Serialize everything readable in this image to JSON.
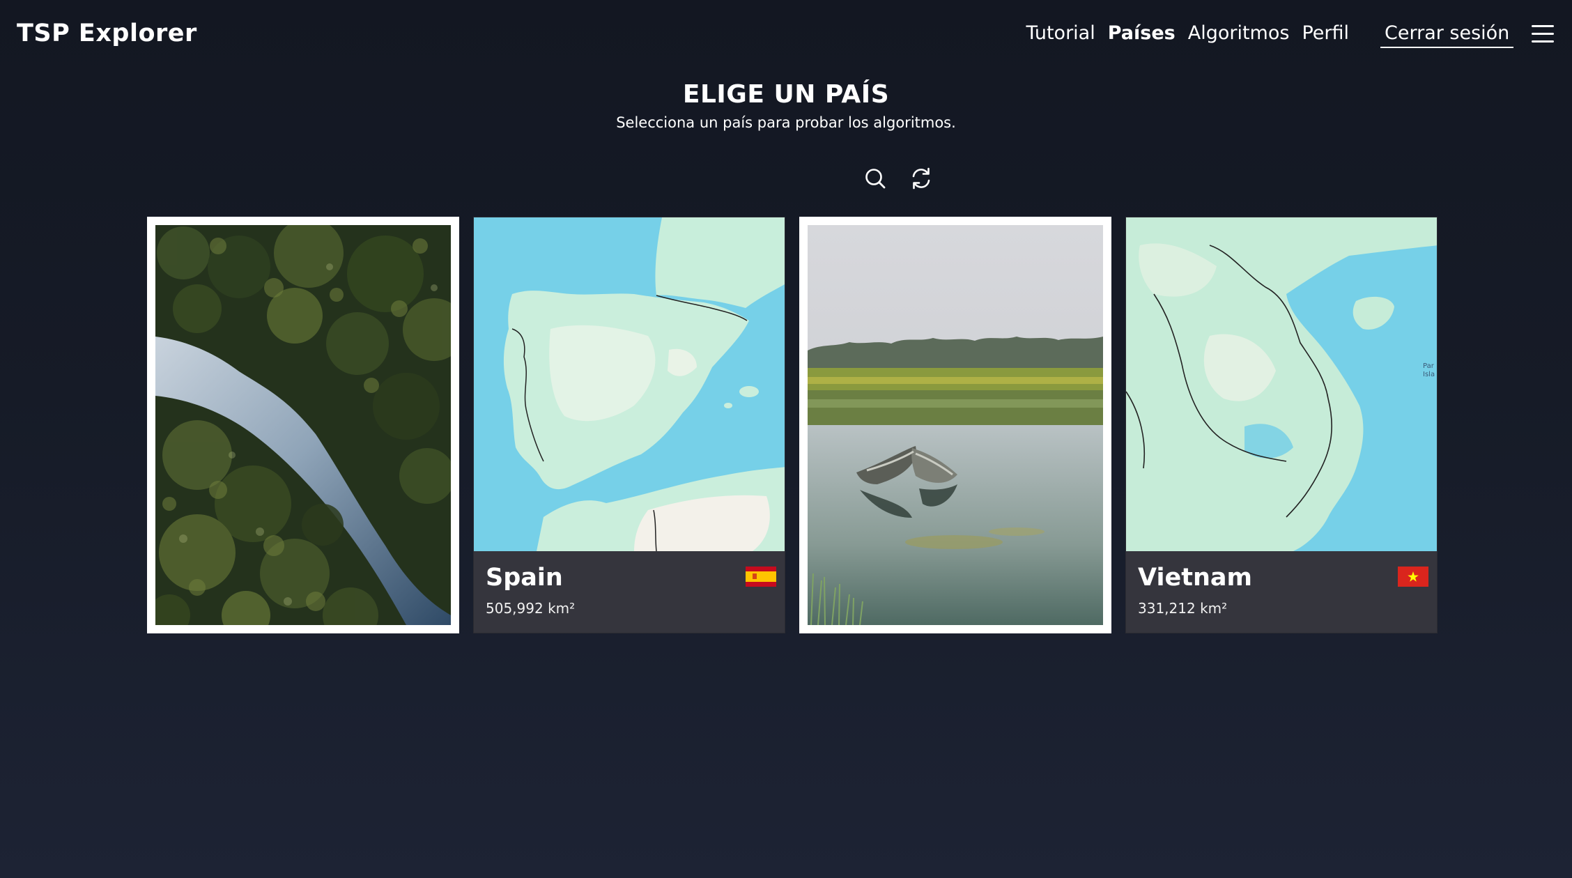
{
  "app": {
    "brand": "TSP Explorer"
  },
  "nav": {
    "links": [
      "Tutorial",
      "Países",
      "Algoritmos",
      "Perfil"
    ],
    "active": "Países",
    "logout": "Cerrar sesión",
    "menu_icon": "hamburger-menu-icon"
  },
  "header": {
    "title": "ELIGE UN PAÍS",
    "subtitle": "Selecciona un país para probar los algoritmos."
  },
  "tools": {
    "search_icon": "search-icon",
    "refresh_icon": "refresh-icon"
  },
  "cards": [
    {
      "kind": "photo",
      "image": "aerial-rainforest-river-photo"
    },
    {
      "kind": "map",
      "name": "Spain",
      "area": "505,992 km²",
      "flag": "spain-flag-icon"
    },
    {
      "kind": "photo",
      "image": "wooden-boats-on-lake-photo"
    },
    {
      "kind": "map",
      "name": "Vietnam",
      "area": "331,212 km²",
      "flag": "vietnam-flag-icon"
    }
  ],
  "colors": {
    "background": "#151a25",
    "card_footer": "#35353d",
    "map_sea": "#76d0e8",
    "map_land": "#c9ecd9"
  }
}
